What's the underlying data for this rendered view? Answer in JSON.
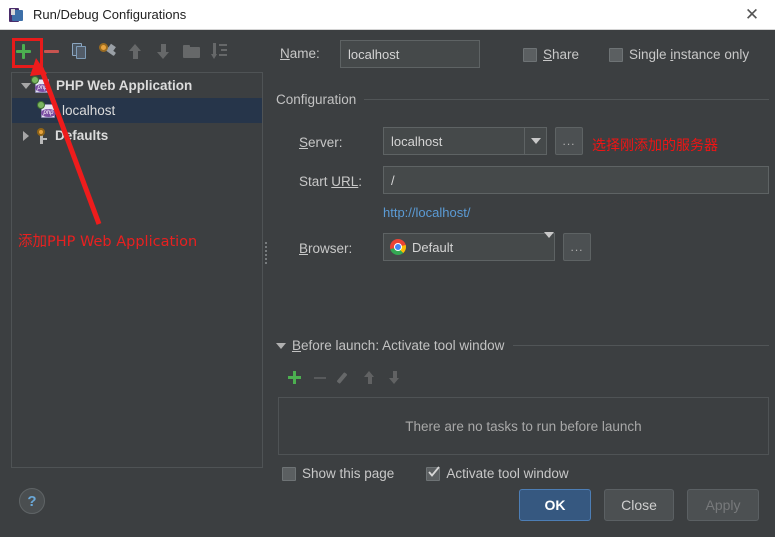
{
  "window": {
    "title": "Run/Debug Configurations",
    "app_icon": "phpstorm-icon",
    "close_label": "✕"
  },
  "toolbar": {
    "buttons": [
      {
        "name": "add-configuration",
        "icon": "plus-icon",
        "label": "Add New Configuration"
      },
      {
        "name": "remove-configuration",
        "icon": "minus-icon",
        "label": "Remove Configuration"
      },
      {
        "name": "copy-configuration",
        "icon": "copy-icon",
        "label": "Copy Configuration"
      },
      {
        "name": "edit-templates",
        "icon": "wrench-icon",
        "label": "Edit Templates"
      },
      {
        "name": "move-up",
        "icon": "arrow-up-icon",
        "label": "Move Up"
      },
      {
        "name": "move-down",
        "icon": "arrow-down-icon",
        "label": "Move Down"
      },
      {
        "name": "move-into-folder",
        "icon": "folder-icon",
        "label": "Create New Folder"
      },
      {
        "name": "sort-configurations",
        "icon": "sort-icon",
        "label": "Sort Configurations"
      }
    ]
  },
  "tree": {
    "nodes": [
      {
        "label": "PHP Web Application",
        "icon": "php-web-icon",
        "expanded": true,
        "selected": false,
        "level": 0
      },
      {
        "label": "localhost",
        "icon": "php-web-icon",
        "expanded": null,
        "selected": true,
        "level": 1
      },
      {
        "label": "Defaults",
        "icon": "defaults-icon",
        "expanded": false,
        "selected": false,
        "level": 0
      }
    ]
  },
  "form": {
    "name_label": "Name:",
    "name_label_mnemonic": "N",
    "name_value": "localhost",
    "name_placeholder": "Name",
    "share": {
      "label": "Share",
      "mnemonic": "S",
      "checked": false
    },
    "single_instance": {
      "label": "Single instance only",
      "mnemonic": "i",
      "checked": false
    },
    "configuration_group": "Configuration",
    "server": {
      "label": "Server:",
      "mnemonic": "S",
      "value": "localhost",
      "browse_label": "..."
    },
    "start_url": {
      "label": "Start URL:",
      "mnemonic": "URL",
      "value": "/",
      "placeholder": "/"
    },
    "preview_url": "http://localhost/",
    "browser": {
      "label": "Browser:",
      "mnemonic": "B",
      "value": "Default",
      "icon": "chrome-icon",
      "browse_label": "..."
    },
    "before_launch": {
      "title_prefix": "Before launch: ",
      "title_suffix": "Activate tool window",
      "title_full": "Before launch: Activate tool window",
      "mnemonic": "B",
      "expanded": true,
      "empty_text": "There are no tasks to run before launch",
      "toolbar": [
        {
          "name": "add-task-button",
          "icon": "plus-icon",
          "enabled": true
        },
        {
          "name": "remove-task-button",
          "icon": "minus-icon",
          "enabled": false
        },
        {
          "name": "edit-task-button",
          "icon": "pencil-icon",
          "enabled": false
        },
        {
          "name": "move-task-up-button",
          "icon": "arrow-up-icon",
          "enabled": false
        },
        {
          "name": "move-task-down-button",
          "icon": "arrow-down-icon",
          "enabled": false
        }
      ]
    },
    "show_this_page": {
      "label": "Show this page",
      "checked": false
    },
    "activate_tool_window": {
      "label": "Activate tool window",
      "checked": true
    }
  },
  "footer": {
    "help_label": "?",
    "ok_label": "OK",
    "close_label": "Close",
    "apply_label": "Apply"
  },
  "annotations": {
    "add_php_web_application": "添加PHP Web Application",
    "select_added_server": "选择刚添加的服务器",
    "highlight_color": "#e81b1b",
    "arrow_color": "#ee1c1c"
  },
  "colors": {
    "window_background": "#3c3f41",
    "titlebar_background": "#ffffff",
    "selection_background": "#26354a",
    "field_background": "#45494a",
    "link": "#5b9bd5",
    "accent_primary_button": "#365880",
    "plus_green": "#4caf50",
    "minus_red": "#c75450"
  }
}
